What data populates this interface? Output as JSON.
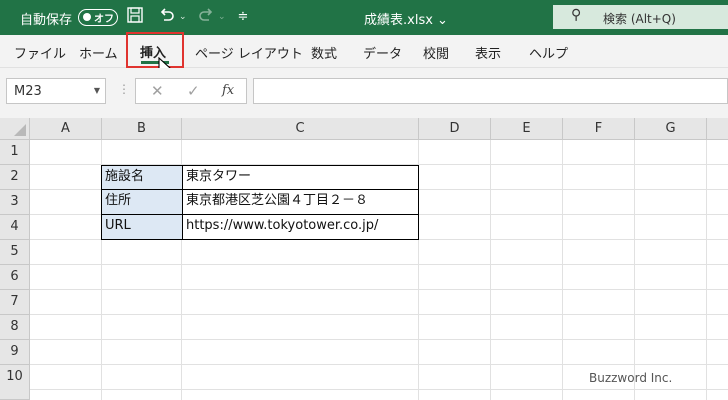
{
  "titlebar": {
    "autosave_label": "自動保存",
    "toggle_state": "オフ",
    "save_icon": "save-icon",
    "undo_icon": "undo-icon",
    "redo_icon": "redo-icon",
    "customize_icon": "customize-icon",
    "filename": "成績表.xlsx ⌄",
    "search_placeholder": "検索 (Alt+Q)"
  },
  "ribbon": {
    "tabs": [
      "ファイル",
      "ホーム",
      "挿入",
      "ページ レイアウト",
      "数式",
      "データ",
      "校閲",
      "表示",
      "ヘルプ"
    ],
    "active_tab": "挿入",
    "highlight_color": "#e0342f",
    "accent_color": "#217346"
  },
  "formula_bar": {
    "name_box": "M23",
    "cancel_symbol": "✕",
    "enter_symbol": "✓",
    "fx_symbol": "fx",
    "content": ""
  },
  "sheet": {
    "columns": [
      "A",
      "B",
      "C",
      "D",
      "E",
      "F",
      "G"
    ],
    "rows": [
      "1",
      "2",
      "3",
      "4",
      "5",
      "6",
      "7",
      "8",
      "9",
      "10"
    ],
    "table": [
      {
        "label": "施設名",
        "value": "東京タワー"
      },
      {
        "label": "住所",
        "value": "東京都港区芝公園４丁目２－８"
      },
      {
        "label": "URL",
        "value": "https://www.tokyotower.co.jp/"
      }
    ],
    "label_fill": "#dde8f4"
  },
  "watermark": "Buzzword Inc."
}
